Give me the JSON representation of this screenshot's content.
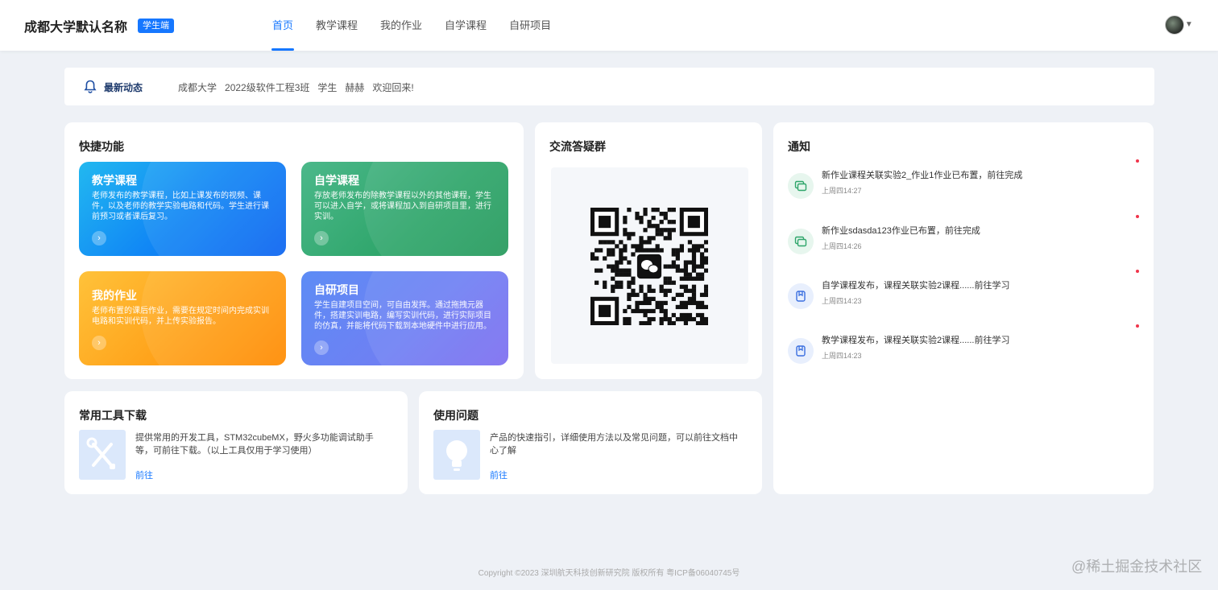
{
  "header": {
    "brand": "成都大学默认名称",
    "role_badge": "学生端",
    "nav": [
      "首页",
      "教学课程",
      "我的作业",
      "自学课程",
      "自研项目"
    ],
    "active_nav": "首页"
  },
  "notice": {
    "title": "最新动态",
    "parts": [
      "成都大学",
      "2022级软件工程3班",
      "学生",
      "赫赫",
      "欢迎回来!"
    ]
  },
  "quick": {
    "title": "快捷功能",
    "tiles": [
      {
        "title": "教学课程",
        "desc": "老师发布的教学课程，比如上课发布的视频、课件，以及老师的教学实验电路和代码。学生进行课前预习或者课后复习。",
        "arrow": "›"
      },
      {
        "title": "自学课程",
        "desc": "存放老师发布的除教学课程以外的其他课程，学生可以进入自学，或将课程加入到自研项目里，进行实训。",
        "arrow": "›"
      },
      {
        "title": "我的作业",
        "desc": "老师布置的课后作业，需要在规定时间内完成实训电路和实训代码，并上传实验报告。",
        "arrow": "›"
      },
      {
        "title": "自研项目",
        "desc": "学生自建项目空间，可自由发挥。通过拖拽元器件，搭建实训电路，编写实训代码，进行实际项目的仿真，并能将代码下载到本地硬件中进行应用。",
        "arrow": "›"
      }
    ]
  },
  "qr": {
    "title": "交流答疑群"
  },
  "notifications": {
    "title": "通知",
    "items": [
      {
        "text": "新作业课程关联实验2_作业1作业已布置，前往完成",
        "time": "上周四14:27",
        "icon": "homework-icon"
      },
      {
        "text": "新作业sdasda123作业已布置，前往完成",
        "time": "上周四14:26",
        "icon": "homework-icon"
      },
      {
        "text": "自学课程发布，课程关联实验2课程......前往学习",
        "time": "上周四14:23",
        "icon": "course-icon"
      },
      {
        "text": "教学课程发布，课程关联实验2课程......前往学习",
        "time": "上周四14:23",
        "icon": "course-icon"
      }
    ]
  },
  "tools": {
    "title": "常用工具下载",
    "desc": "提供常用的开发工具，STM32cubeMX，野火多功能调试助手等，可前往下载。（以上工具仅用于学习使用）",
    "link": "前往"
  },
  "usage": {
    "title": "使用问题",
    "desc": "产品的快速指引，详细使用方法以及常见问题，可以前往文档中心了解",
    "link": "前往"
  },
  "footer": "Copyright ©2023  深圳航天科技创新研究院  版权所有  粤ICP备06040745号",
  "watermark": "@稀土掘金技术社区",
  "colors": {
    "accent": "#1677ff",
    "dot": "#f0354b"
  }
}
